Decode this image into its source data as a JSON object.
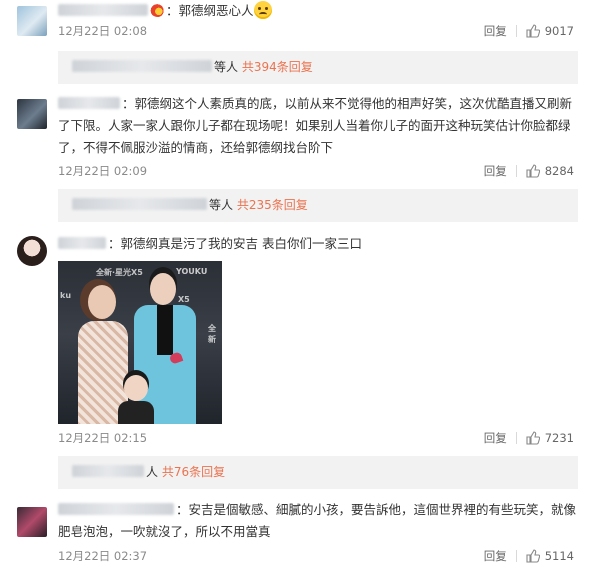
{
  "comments": [
    {
      "text": "：郭德纲恶心人",
      "time": "12月22日 02:08",
      "reply_label": "回复",
      "likes": "9017",
      "replies": {
        "suffix": "等人",
        "link": "共394条回复"
      }
    },
    {
      "text": "：郭德纲这个人素质真的底，以前从来不觉得他的相声好笑，这次优酷直播又刷新了下限。人家一家人跟你儿子都在现场呢！如果别人当着你儿子的面开这种玩笑估计你脸都绿了，不得不佩服沙溢的情商，还给郭德纲找台阶下",
      "time": "12月22日 02:09",
      "reply_label": "回复",
      "likes": "8284",
      "replies": {
        "suffix": "等人",
        "link": "共235条回复"
      }
    },
    {
      "text": "：郭德纲真是污了我的安吉 表白你们一家三口",
      "time": "12月22日 02:15",
      "reply_label": "回复",
      "likes": "7231",
      "replies": {
        "suffix": "人",
        "link": "共76条回复"
      },
      "photo_logos": [
        "全新·星光X5",
        "YOUKU",
        "ku",
        "X5",
        "全新"
      ]
    },
    {
      "text": "：安吉是個敏感、細膩的小孩，要告訴他，這個世界裡的有些玩笑，就像肥皂泡泡，一吹就沒了，所以不用當真",
      "time": "12月22日 02:37",
      "reply_label": "回复",
      "likes": "5114"
    }
  ]
}
